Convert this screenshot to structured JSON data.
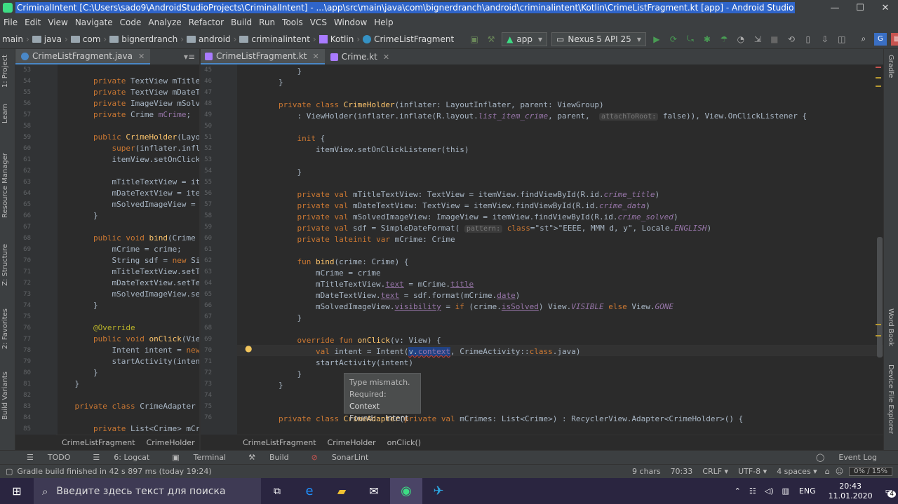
{
  "window": {
    "title": "CriminalIntent [C:\\Users\\sado9\\AndroidStudioProjects\\CriminalIntent] - ...\\app\\src\\main\\java\\com\\bignerdranch\\android\\criminalintent\\Kotlin\\CrimeListFragment.kt [app] - Android Studio"
  },
  "menu": [
    "File",
    "Edit",
    "View",
    "Navigate",
    "Code",
    "Analyze",
    "Refactor",
    "Build",
    "Run",
    "Tools",
    "VCS",
    "Window",
    "Help"
  ],
  "breadcrumbs": [
    "main",
    "java",
    "com",
    "bignerdranch",
    "android",
    "criminalintent",
    "Kotlin",
    "CrimeListFragment"
  ],
  "toolbar": {
    "config": "app",
    "device": "Nexus 5 API 25"
  },
  "left_tabs": [
    "1: Project",
    "Learn",
    "Resource Manager",
    "Z: Structure",
    "2: Favorites",
    "Build Variants"
  ],
  "right_tabs": [
    "Gradle",
    "Word Book",
    "Device File Explorer"
  ],
  "left_tab": {
    "label": "CrimeListFragment.java"
  },
  "right_tabs_editor": [
    {
      "label": "CrimeListFragment.kt",
      "active": true
    },
    {
      "label": "Crime.kt",
      "active": false
    }
  ],
  "left_lines": [
    {
      "n": "53",
      "t": ""
    },
    {
      "n": "54",
      "t": "        private TextView mTitleTex"
    },
    {
      "n": "55",
      "t": "        private TextView mDateText"
    },
    {
      "n": "56",
      "t": "        private ImageView mSolvedI"
    },
    {
      "n": "57",
      "t": "        private Crime mCrime;"
    },
    {
      "n": "58",
      "t": ""
    },
    {
      "n": "59",
      "t": "        public CrimeHolder(LayoutI"
    },
    {
      "n": "60",
      "t": "            super(inflater.inflate"
    },
    {
      "n": "61",
      "t": "            itemView.setOnClickLis"
    },
    {
      "n": "62",
      "t": ""
    },
    {
      "n": "63",
      "t": "            mTitleTextView = itemV"
    },
    {
      "n": "64",
      "t": "            mDateTextView = itemVi"
    },
    {
      "n": "65",
      "t": "            mSolvedImageView = ite"
    },
    {
      "n": "66",
      "t": "        }"
    },
    {
      "n": "67",
      "t": ""
    },
    {
      "n": "68",
      "t": "        public void bind(Crime cri"
    },
    {
      "n": "69",
      "t": "            mCrime = crime;"
    },
    {
      "n": "70",
      "t": "            String sdf = new Simpl"
    },
    {
      "n": "71",
      "t": "            mTitleTextView.setText"
    },
    {
      "n": "72",
      "t": "            mDateTextView.setText("
    },
    {
      "n": "73",
      "t": "            mSolvedImageView.setVi"
    },
    {
      "n": "74",
      "t": "        }"
    },
    {
      "n": "75",
      "t": ""
    },
    {
      "n": "76",
      "t": "        @Override"
    },
    {
      "n": "77",
      "t": "        public void onClick(View v"
    },
    {
      "n": "78",
      "t": "            Intent intent = new In"
    },
    {
      "n": "79",
      "t": "            startActivity(intent);"
    },
    {
      "n": "80",
      "t": "        }"
    },
    {
      "n": "81",
      "t": "    }"
    },
    {
      "n": "82",
      "t": ""
    },
    {
      "n": "83",
      "t": "    private class CrimeAdapter ext"
    },
    {
      "n": "84",
      "t": ""
    },
    {
      "n": "85",
      "t": "        private List<Crime> mCrime"
    }
  ],
  "right_lines": [
    {
      "n": "45",
      "t": "            }"
    },
    {
      "n": "46",
      "t": "        }"
    },
    {
      "n": "47",
      "t": ""
    },
    {
      "n": "48",
      "t": "        private class CrimeHolder(inflater: LayoutInflater, parent: ViewGroup)"
    },
    {
      "n": "49",
      "t": "            : ViewHolder(inflater.inflate(R.layout.list_item_crime, parent,  attachToRoot: false)), View.OnClickListener {"
    },
    {
      "n": "50",
      "t": ""
    },
    {
      "n": "51",
      "t": "            init {"
    },
    {
      "n": "52",
      "t": "                itemView.setOnClickListener(this)"
    },
    {
      "n": "53",
      "t": ""
    },
    {
      "n": "54",
      "t": "            }"
    },
    {
      "n": "55",
      "t": ""
    },
    {
      "n": "56",
      "t": "            private val mTitleTextView: TextView = itemView.findViewById(R.id.crime_title)"
    },
    {
      "n": "57",
      "t": "            private val mDateTextView: TextView = itemView.findViewById(R.id.crime_data)"
    },
    {
      "n": "58",
      "t": "            private val mSolvedImageView: ImageView = itemView.findViewById(R.id.crime_solved)"
    },
    {
      "n": "59",
      "t": "            private val sdf = SimpleDateFormat( pattern: \"EEEE, MMM d, y\", Locale.ENGLISH)"
    },
    {
      "n": "60",
      "t": "            private lateinit var mCrime: Crime"
    },
    {
      "n": "61",
      "t": ""
    },
    {
      "n": "62",
      "t": "            fun bind(crime: Crime) {"
    },
    {
      "n": "63",
      "t": "                mCrime = crime"
    },
    {
      "n": "64",
      "t": "                mTitleTextView.text = mCrime.title"
    },
    {
      "n": "65",
      "t": "                mDateTextView.text = sdf.format(mCrime.date)"
    },
    {
      "n": "66",
      "t": "                mSolvedImageView.visibility = if (crime.isSolved) View.VISIBLE else View.GONE"
    },
    {
      "n": "67",
      "t": "            }"
    },
    {
      "n": "68",
      "t": ""
    },
    {
      "n": "69",
      "t": "            override fun onClick(v: View) {"
    },
    {
      "n": "70",
      "t": "                val intent = Intent(v.context, CrimeActivity::class.java)"
    },
    {
      "n": "71",
      "t": "                startActivity(intent)"
    },
    {
      "n": "72",
      "t": "            }"
    },
    {
      "n": "73",
      "t": "        }"
    },
    {
      "n": "74",
      "t": ""
    },
    {
      "n": "75",
      "t": ""
    },
    {
      "n": "76",
      "t": "        private class CrimeAdapter(private val mCrimes: List<Crime>) : RecyclerView.Adapter<CrimeHolder>() {"
    }
  ],
  "tooltip": {
    "line1": "Type mismatch.",
    "req_label": "Required:",
    "req_val": "Context",
    "found_label": "Found:",
    "found_val": "Intent"
  },
  "left_crumbs": [
    "CrimeListFragment",
    "CrimeHolder"
  ],
  "right_crumbs": [
    "CrimeListFragment",
    "CrimeHolder",
    "onClick()"
  ],
  "toolwindows": [
    "TODO",
    "6: Logcat",
    "Terminal",
    "Build",
    "SonarLint"
  ],
  "event_log": "Event Log",
  "status": {
    "message": "Gradle build finished in 42 s 897 ms (today 19:24)",
    "chars": "9 chars",
    "pos": "70:33",
    "crlf": "CRLF",
    "enc": "UTF-8",
    "indent": "4 spaces",
    "mem": "0% / 15%"
  },
  "taskbar": {
    "search": "Введите здесь текст для поиска",
    "lang": "ENG",
    "time": "20:43",
    "date": "11.01.2020",
    "notif": "4"
  }
}
